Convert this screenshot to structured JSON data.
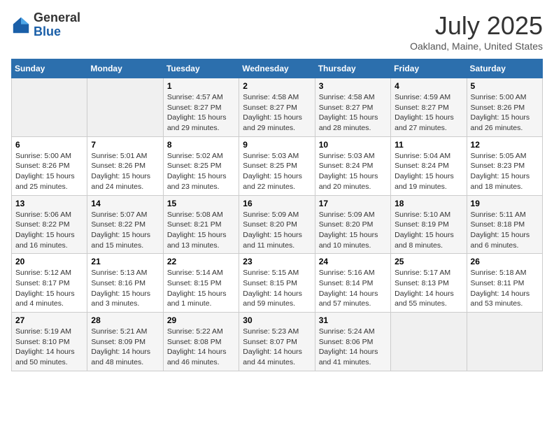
{
  "header": {
    "logo_general": "General",
    "logo_blue": "Blue",
    "month": "July 2025",
    "location": "Oakland, Maine, United States"
  },
  "days_of_week": [
    "Sunday",
    "Monday",
    "Tuesday",
    "Wednesday",
    "Thursday",
    "Friday",
    "Saturday"
  ],
  "weeks": [
    [
      {
        "day": "",
        "info": ""
      },
      {
        "day": "",
        "info": ""
      },
      {
        "day": "1",
        "info": "Sunrise: 4:57 AM\nSunset: 8:27 PM\nDaylight: 15 hours\nand 29 minutes."
      },
      {
        "day": "2",
        "info": "Sunrise: 4:58 AM\nSunset: 8:27 PM\nDaylight: 15 hours\nand 29 minutes."
      },
      {
        "day": "3",
        "info": "Sunrise: 4:58 AM\nSunset: 8:27 PM\nDaylight: 15 hours\nand 28 minutes."
      },
      {
        "day": "4",
        "info": "Sunrise: 4:59 AM\nSunset: 8:27 PM\nDaylight: 15 hours\nand 27 minutes."
      },
      {
        "day": "5",
        "info": "Sunrise: 5:00 AM\nSunset: 8:26 PM\nDaylight: 15 hours\nand 26 minutes."
      }
    ],
    [
      {
        "day": "6",
        "info": "Sunrise: 5:00 AM\nSunset: 8:26 PM\nDaylight: 15 hours\nand 25 minutes."
      },
      {
        "day": "7",
        "info": "Sunrise: 5:01 AM\nSunset: 8:26 PM\nDaylight: 15 hours\nand 24 minutes."
      },
      {
        "day": "8",
        "info": "Sunrise: 5:02 AM\nSunset: 8:25 PM\nDaylight: 15 hours\nand 23 minutes."
      },
      {
        "day": "9",
        "info": "Sunrise: 5:03 AM\nSunset: 8:25 PM\nDaylight: 15 hours\nand 22 minutes."
      },
      {
        "day": "10",
        "info": "Sunrise: 5:03 AM\nSunset: 8:24 PM\nDaylight: 15 hours\nand 20 minutes."
      },
      {
        "day": "11",
        "info": "Sunrise: 5:04 AM\nSunset: 8:24 PM\nDaylight: 15 hours\nand 19 minutes."
      },
      {
        "day": "12",
        "info": "Sunrise: 5:05 AM\nSunset: 8:23 PM\nDaylight: 15 hours\nand 18 minutes."
      }
    ],
    [
      {
        "day": "13",
        "info": "Sunrise: 5:06 AM\nSunset: 8:22 PM\nDaylight: 15 hours\nand 16 minutes."
      },
      {
        "day": "14",
        "info": "Sunrise: 5:07 AM\nSunset: 8:22 PM\nDaylight: 15 hours\nand 15 minutes."
      },
      {
        "day": "15",
        "info": "Sunrise: 5:08 AM\nSunset: 8:21 PM\nDaylight: 15 hours\nand 13 minutes."
      },
      {
        "day": "16",
        "info": "Sunrise: 5:09 AM\nSunset: 8:20 PM\nDaylight: 15 hours\nand 11 minutes."
      },
      {
        "day": "17",
        "info": "Sunrise: 5:09 AM\nSunset: 8:20 PM\nDaylight: 15 hours\nand 10 minutes."
      },
      {
        "day": "18",
        "info": "Sunrise: 5:10 AM\nSunset: 8:19 PM\nDaylight: 15 hours\nand 8 minutes."
      },
      {
        "day": "19",
        "info": "Sunrise: 5:11 AM\nSunset: 8:18 PM\nDaylight: 15 hours\nand 6 minutes."
      }
    ],
    [
      {
        "day": "20",
        "info": "Sunrise: 5:12 AM\nSunset: 8:17 PM\nDaylight: 15 hours\nand 4 minutes."
      },
      {
        "day": "21",
        "info": "Sunrise: 5:13 AM\nSunset: 8:16 PM\nDaylight: 15 hours\nand 3 minutes."
      },
      {
        "day": "22",
        "info": "Sunrise: 5:14 AM\nSunset: 8:15 PM\nDaylight: 15 hours\nand 1 minute."
      },
      {
        "day": "23",
        "info": "Sunrise: 5:15 AM\nSunset: 8:15 PM\nDaylight: 14 hours\nand 59 minutes."
      },
      {
        "day": "24",
        "info": "Sunrise: 5:16 AM\nSunset: 8:14 PM\nDaylight: 14 hours\nand 57 minutes."
      },
      {
        "day": "25",
        "info": "Sunrise: 5:17 AM\nSunset: 8:13 PM\nDaylight: 14 hours\nand 55 minutes."
      },
      {
        "day": "26",
        "info": "Sunrise: 5:18 AM\nSunset: 8:11 PM\nDaylight: 14 hours\nand 53 minutes."
      }
    ],
    [
      {
        "day": "27",
        "info": "Sunrise: 5:19 AM\nSunset: 8:10 PM\nDaylight: 14 hours\nand 50 minutes."
      },
      {
        "day": "28",
        "info": "Sunrise: 5:21 AM\nSunset: 8:09 PM\nDaylight: 14 hours\nand 48 minutes."
      },
      {
        "day": "29",
        "info": "Sunrise: 5:22 AM\nSunset: 8:08 PM\nDaylight: 14 hours\nand 46 minutes."
      },
      {
        "day": "30",
        "info": "Sunrise: 5:23 AM\nSunset: 8:07 PM\nDaylight: 14 hours\nand 44 minutes."
      },
      {
        "day": "31",
        "info": "Sunrise: 5:24 AM\nSunset: 8:06 PM\nDaylight: 14 hours\nand 41 minutes."
      },
      {
        "day": "",
        "info": ""
      },
      {
        "day": "",
        "info": ""
      }
    ]
  ]
}
